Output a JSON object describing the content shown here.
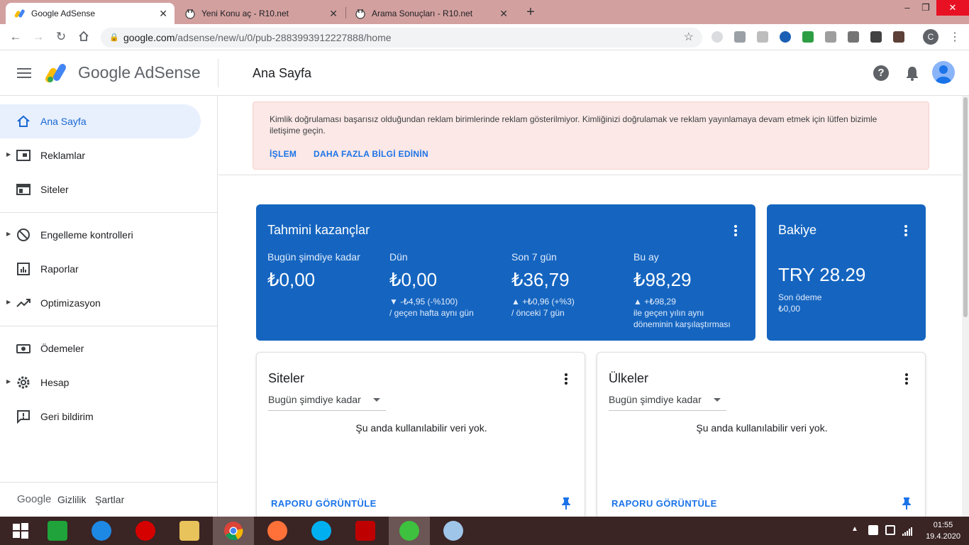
{
  "browser": {
    "tabs": [
      {
        "title": "Google AdSense",
        "active": true
      },
      {
        "title": "Yeni Konu aç - R10.net",
        "active": false
      },
      {
        "title": "Arama Sonuçları - R10.net",
        "active": false
      }
    ],
    "new_tab_icon": "plus-icon",
    "url_host": "google.com",
    "url_path": "/adsense/new/u/0/pub-2883993912227888/home",
    "profile_letter": "C"
  },
  "header": {
    "logo_text": "Google AdSense",
    "page_title": "Ana Sayfa"
  },
  "sidebar": {
    "items": [
      {
        "label": "Ana Sayfa",
        "icon": "home-icon",
        "active": true,
        "expandable": false
      },
      {
        "label": "Reklamlar",
        "icon": "ads-icon",
        "active": false,
        "expandable": true
      },
      {
        "label": "Siteler",
        "icon": "sites-icon",
        "active": false,
        "expandable": false
      },
      {
        "label": "Engelleme kontrolleri",
        "icon": "block-icon",
        "active": false,
        "expandable": true
      },
      {
        "label": "Raporlar",
        "icon": "reports-icon",
        "active": false,
        "expandable": false
      },
      {
        "label": "Optimizasyon",
        "icon": "trending-icon",
        "active": false,
        "expandable": true
      },
      {
        "label": "Ödemeler",
        "icon": "payments-icon",
        "active": false,
        "expandable": false
      },
      {
        "label": "Hesap",
        "icon": "gear-icon",
        "active": false,
        "expandable": true
      },
      {
        "label": "Geri bildirim",
        "icon": "feedback-icon",
        "active": false,
        "expandable": false
      }
    ],
    "footer": {
      "google": "Google",
      "privacy": "Gizlilik",
      "terms": "Şartlar"
    }
  },
  "alert": {
    "message": "Kimlik doğrulaması başarısız olduğundan reklam birimlerinde reklam gösterilmiyor. Kimliğinizi doğrulamak ve reklam yayınlamaya devam etmek için lütfen bizimle iletişime geçin.",
    "action_label": "İŞLEM",
    "more_label": "DAHA FAZLA BİLGİ EDİNİN"
  },
  "earnings": {
    "title": "Tahmini kazançlar",
    "metrics": [
      {
        "label": "Bugün şimdiye kadar",
        "value": "₺0,00",
        "change": "",
        "compare": ""
      },
      {
        "label": "Dün",
        "value": "₺0,00",
        "change": "▼ -₺4,95 (-%100)",
        "compare": "/ geçen hafta aynı gün"
      },
      {
        "label": "Son 7 gün",
        "value": "₺36,79",
        "change": "▲ +₺0,96 (+%3)",
        "compare": "/ önceki 7 gün"
      },
      {
        "label": "Bu ay",
        "value": "₺98,29",
        "change": "▲ +₺98,29",
        "compare": "ile geçen yılın aynı",
        "compare2": "döneminin karşılaştırması"
      }
    ]
  },
  "balance": {
    "title": "Bakiye",
    "value": "TRY 28.29",
    "last_payment_label": "Son ödeme",
    "last_payment_value": "₺0,00"
  },
  "sites_card": {
    "title": "Siteler",
    "period": "Bugün şimdiye kadar",
    "empty": "Şu anda kullanılabilir veri yok.",
    "link": "RAPORU GÖRÜNTÜLE"
  },
  "countries_card": {
    "title": "Ülkeler",
    "period": "Bugün şimdiye kadar",
    "empty": "Şu anda kullanılabilir veri yok.",
    "link": "RAPORU GÖRÜNTÜLE"
  },
  "taskbar": {
    "time": "01:55",
    "date": "19.4.2020"
  },
  "colors": {
    "primary_blue": "#1565c0",
    "link_blue": "#1a73e8",
    "alert_bg": "#fce8e6",
    "active_nav_bg": "#e8f0fe"
  }
}
